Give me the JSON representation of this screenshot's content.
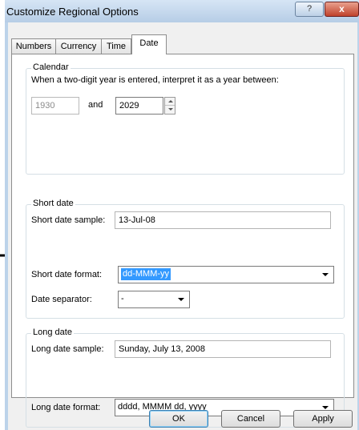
{
  "window": {
    "title": "Customize Regional Options",
    "help_label": "?",
    "close_label": "x"
  },
  "tabs": [
    {
      "label": "Numbers"
    },
    {
      "label": "Currency"
    },
    {
      "label": "Time"
    },
    {
      "label": "Date"
    }
  ],
  "calendar": {
    "legend": "Calendar",
    "instruction": "When a two-digit year is entered, interpret it as a year between:",
    "start_year": "1930",
    "and_label": "and",
    "end_year": "2029"
  },
  "short_date": {
    "legend": "Short date",
    "sample_label": "Short date sample:",
    "sample_value": "13-Jul-08",
    "format_label": "Short date format:",
    "format_value": "dd-MMM-yy",
    "separator_label": "Date separator:",
    "separator_value": "-"
  },
  "long_date": {
    "legend": "Long date",
    "sample_label": "Long date sample:",
    "sample_value": "Sunday, July 13, 2008",
    "format_label": "Long date format:",
    "format_value": "dddd, MMMM dd, yyyy"
  },
  "buttons": {
    "ok": "OK",
    "cancel": "Cancel",
    "apply": "Apply"
  },
  "colors": {
    "frame": "#bcd3ea",
    "close": "#c0422c",
    "selection": "#3399ff"
  }
}
